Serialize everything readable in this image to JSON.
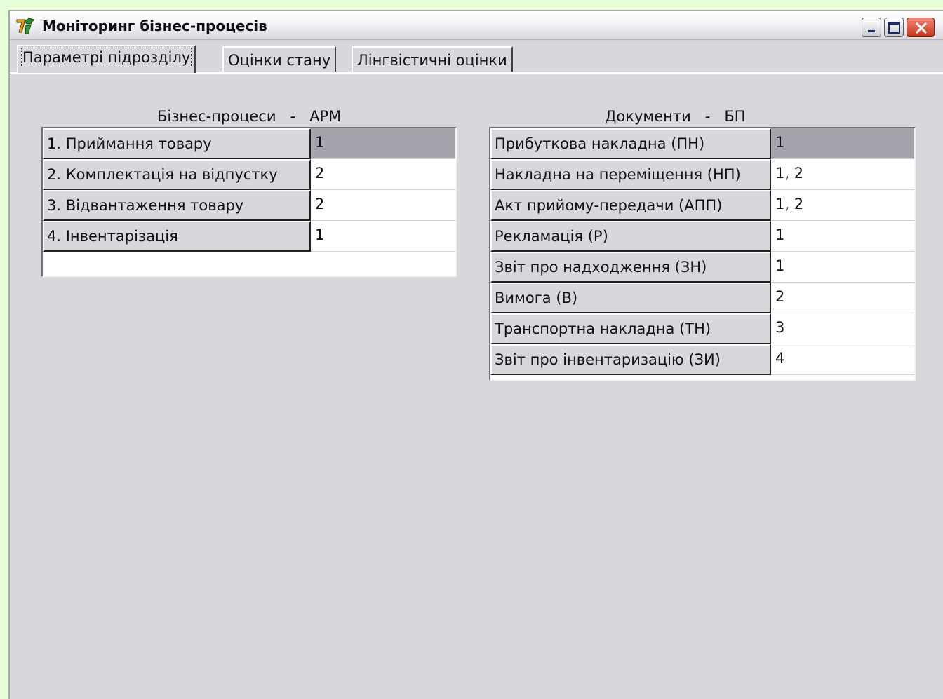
{
  "window": {
    "title": "Моніторинг бізнес-процесів"
  },
  "tabs": [
    {
      "label": "Параметрі підрозділу",
      "active": true
    },
    {
      "label": "Оцінки стану",
      "active": false
    },
    {
      "label": "Лінгвістичні оцінки",
      "active": false
    }
  ],
  "left_table": {
    "caption": "Бізнес-процеси   -   АРМ",
    "rows": [
      {
        "name": "1. Приймання товару",
        "value": "1",
        "selected": true
      },
      {
        "name": "2. Комплектація на відпустку",
        "value": "2"
      },
      {
        "name": "3. Відвантаження товару",
        "value": "2"
      },
      {
        "name": "4. Інвентарізація",
        "value": "1"
      }
    ]
  },
  "right_table": {
    "caption": "Документи   -   БП",
    "rows": [
      {
        "name": "Прибуткова накладна (ПН)",
        "value": "1",
        "selected": true
      },
      {
        "name": "Накладна на переміщення (НП)",
        "value": "1, 2"
      },
      {
        "name": "Акт прийому-передачи (АПП)",
        "value": "1, 2"
      },
      {
        "name": "Рекламація (Р)",
        "value": "1"
      },
      {
        "name": "Звіт про надходження (ЗН)",
        "value": "1"
      },
      {
        "name": "Вимога (В)",
        "value": "2"
      },
      {
        "name": "Транспортна накладна (ТН)",
        "value": "3"
      },
      {
        "name": "Звіт про інвентаризацію (ЗИ)",
        "value": "4"
      }
    ]
  },
  "colors": {
    "selected_cell": "#a4a4ac",
    "window_bg": "#d8d8dc",
    "desktop_bg": "#e6ffd9"
  }
}
